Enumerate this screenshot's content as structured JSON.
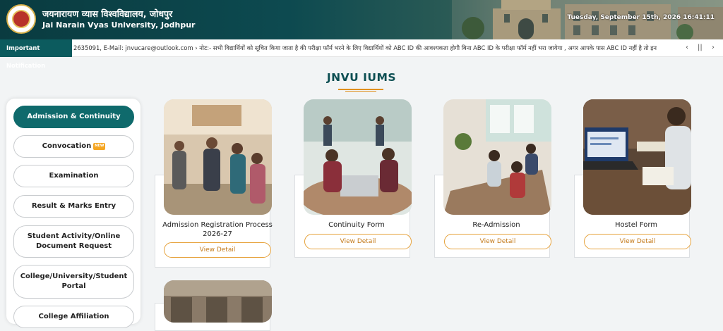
{
  "header": {
    "university_hindi": "जयनारायण व्यास विश्वविद्यालय, जोधपुर",
    "university_english": "Jai Narain Vyas University, Jodhpur",
    "datetime": "Tuesday, September 15th, 2026 16:41:11"
  },
  "notification": {
    "label": "Important Notification",
    "text": "2635091, E-Mail: jnvucare@outlook.com     ›  नोट:- सभी विद्यार्थियों को सूचित किया जाता है की परीक्षा फॉर्म भरने के लिए विद्यार्थियों को ABC ID की आवश्यकता होगी बिना ABC ID के परीक्षा फॉर्म नहीं भरा जायेगा , अगर आपके पास ABC ID नहीं है तो इन",
    "controls": {
      "prev": "‹",
      "pause": "||",
      "next": "›"
    }
  },
  "main": {
    "title": "JNVU IUMS"
  },
  "sidebar": {
    "items": [
      {
        "label": "Admission & Continuity",
        "active": true
      },
      {
        "label": "Convocation",
        "badge": "NEW"
      },
      {
        "label": "Examination"
      },
      {
        "label": "Result & Marks Entry"
      },
      {
        "label": "Student Activity/Online Document Request"
      },
      {
        "label": "College/University/Student Portal"
      },
      {
        "label": "College Affiliation"
      }
    ]
  },
  "cards": [
    {
      "title": "Admission Registration Process 2026-27",
      "button": "View Detail"
    },
    {
      "title": "Continuity Form",
      "button": "View Detail"
    },
    {
      "title": "Re-Admission",
      "button": "View Detail"
    },
    {
      "title": "Hostel Form",
      "button": "View Detail"
    }
  ],
  "colors": {
    "primary": "#0f6a6c",
    "accent": "#e0901f",
    "header_bg": "#0a3b40"
  }
}
